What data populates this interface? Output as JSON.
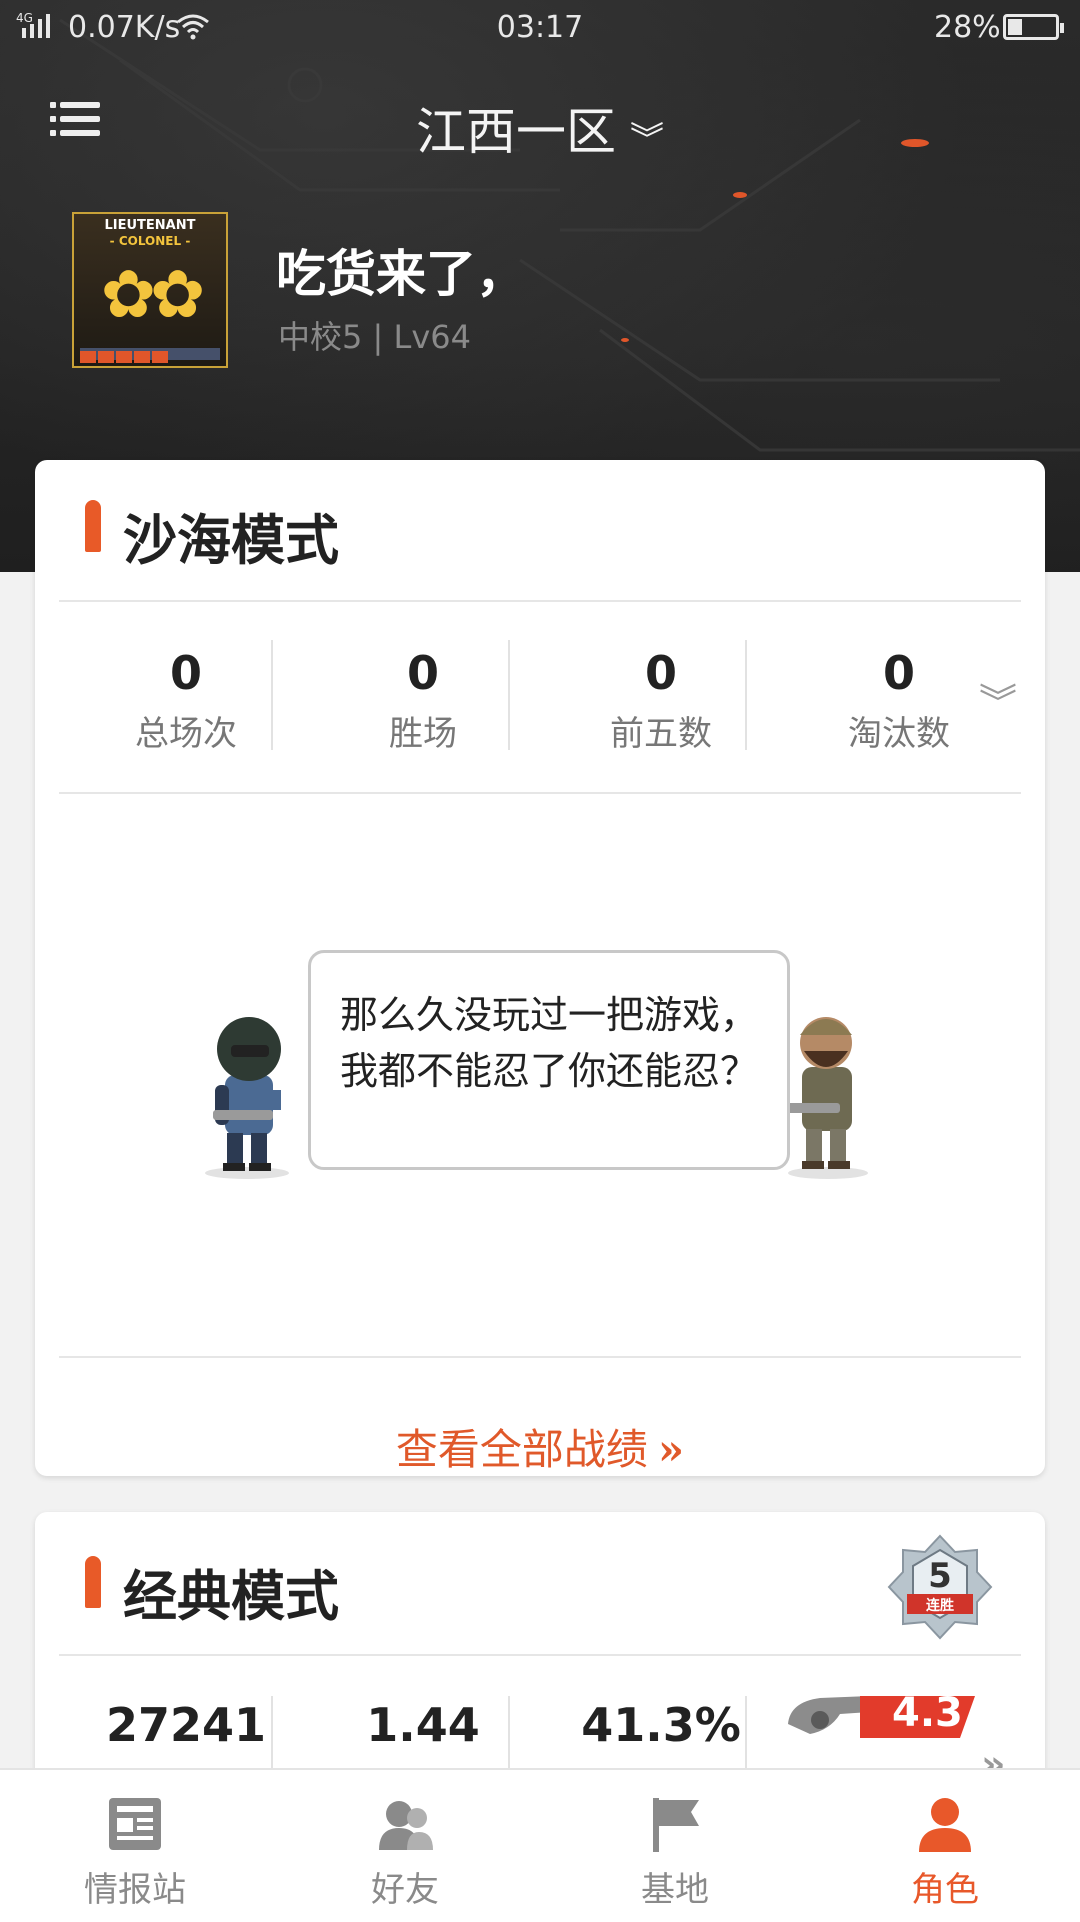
{
  "status_bar": {
    "signal": "4G",
    "speed": "0.07K/s",
    "time": "03:17",
    "battery": "28%",
    "battery_level": 0.28
  },
  "header": {
    "server": "江西一区",
    "player_name": "吃货来了，",
    "rank_level": "中校5 | Lv64",
    "badge": {
      "line1": "LIEUTENANT",
      "line2": "- COLONEL -",
      "progress_pips": 5
    }
  },
  "sand_mode": {
    "title": "沙海模式",
    "stats": [
      {
        "value": "0",
        "label": "总场次"
      },
      {
        "value": "0",
        "label": "胜场"
      },
      {
        "value": "0",
        "label": "前五数"
      },
      {
        "value": "0",
        "label": "淘汰数"
      }
    ],
    "empty_message": "那么久没玩过一把游戏，我都不能忍了你还能忍？",
    "view_all": "查看全部战绩",
    "view_all_arrow": "»"
  },
  "classic_mode": {
    "title": "经典模式",
    "streak_badge": {
      "number": "5",
      "text": "连胜"
    },
    "stats": [
      {
        "value": "27241"
      },
      {
        "value": "1.44"
      },
      {
        "value": "41.3%"
      }
    ],
    "weapon_badge": "4.3",
    "more_arrow": "»"
  },
  "tabbar": {
    "tabs": [
      {
        "label": "情报站",
        "icon": "news-icon",
        "active": false
      },
      {
        "label": "好友",
        "icon": "friends-icon",
        "active": false
      },
      {
        "label": "基地",
        "icon": "flag-icon",
        "active": false
      },
      {
        "label": "角色",
        "icon": "person-icon",
        "active": true
      }
    ]
  },
  "colors": {
    "accent": "#e8582a",
    "header_bg": "#252525",
    "inactive": "#8a8a8a"
  }
}
